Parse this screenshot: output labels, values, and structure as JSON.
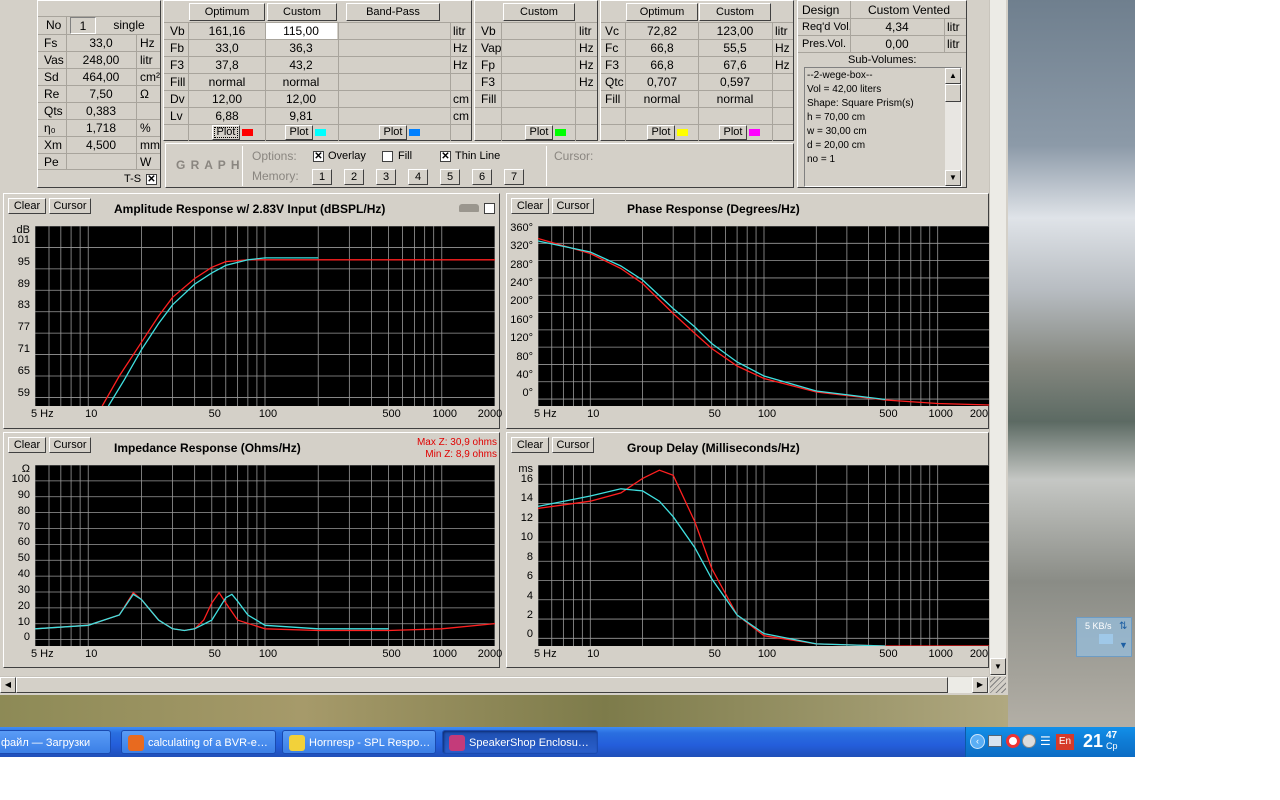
{
  "driver": {
    "no_label": "No",
    "no_value": "1",
    "mode": "single",
    "rows": [
      {
        "label": "Fs",
        "value": "33,0",
        "unit": "Hz"
      },
      {
        "label": "Vas",
        "value": "248,00",
        "unit": "litr"
      },
      {
        "label": "Sd",
        "value": "464,00",
        "unit": "cm²"
      },
      {
        "label": "Re",
        "value": "7,50",
        "unit": "Ω"
      },
      {
        "label": "Qts",
        "value": "0,383",
        "unit": ""
      },
      {
        "label": "η₀",
        "value": "1,718",
        "unit": "%"
      },
      {
        "label": "Xm",
        "value": "4,500",
        "unit": "mm"
      },
      {
        "label": "Pe",
        "value": "",
        "unit": "W"
      }
    ],
    "ts_label": "T-S"
  },
  "vented": {
    "optimum_label": "Optimum",
    "custom_label": "Custom",
    "rows": [
      {
        "label": "Vb",
        "opt": "161,16",
        "cust": "115,00",
        "unit": "litr"
      },
      {
        "label": "Fb",
        "opt": "33,0",
        "cust": "36,3",
        "unit": "Hz"
      },
      {
        "label": "F3",
        "opt": "37,8",
        "cust": "43,2",
        "unit": "Hz"
      },
      {
        "label": "Fill",
        "opt": "normal",
        "cust": "normal",
        "unit": ""
      },
      {
        "label": "Dv",
        "opt": "12,00",
        "cust": "12,00",
        "unit": "cm"
      },
      {
        "label": "Lv",
        "opt": "6,88",
        "cust": "9,81",
        "unit": "cm"
      }
    ]
  },
  "bandpass": {
    "label": "Band-Pass",
    "units": [
      "litr",
      "Hz",
      "Hz",
      "",
      "cm",
      "cm"
    ]
  },
  "passive": {
    "custom_label": "Custom",
    "rows": [
      {
        "label": "Vb",
        "unit": "litr"
      },
      {
        "label": "Vap",
        "unit": "Hz"
      },
      {
        "label": "Fp",
        "unit": "Hz"
      },
      {
        "label": "F3",
        "unit": "Hz"
      },
      {
        "label": "Fill",
        "unit": ""
      }
    ]
  },
  "closed": {
    "optimum_label": "Optimum",
    "custom_label": "Custom",
    "rows": [
      {
        "label": "Vc",
        "opt": "72,82",
        "cust": "123,00",
        "unit": "litr"
      },
      {
        "label": "Fc",
        "opt": "66,8",
        "cust": "55,5",
        "unit": "Hz"
      },
      {
        "label": "F3",
        "opt": "66,8",
        "cust": "67,6",
        "unit": "Hz"
      },
      {
        "label": "Qtc",
        "opt": "0,707",
        "cust": "0,597",
        "unit": ""
      },
      {
        "label": "Fill",
        "opt": "normal",
        "cust": "normal",
        "unit": ""
      }
    ]
  },
  "plot_label": "Plot",
  "plot_colors": {
    "vent_opt": "#ff0000",
    "vent_cust": "#00ffff",
    "bp": "#0080ff",
    "passive": "#00ff00",
    "closed_opt": "#ffff00",
    "closed_cust": "#ff00ff"
  },
  "design": {
    "design_label": "Design",
    "design_value": "Custom Vented",
    "reqd_label": "Req'd Vol.",
    "reqd_value": "4,34",
    "reqd_unit": "litr",
    "pres_label": "Pres.Vol.",
    "pres_value": "0,00",
    "pres_unit": "litr",
    "sub_label": "Sub-Volumes:",
    "sub_lines": [
      "--2-wege-box--",
      "Vol = 42,00 liters",
      "Shape: Square Prism(s)",
      "h = 70,00 cm",
      "w = 30,00 cm",
      "d = 20,00 cm",
      "no = 1"
    ]
  },
  "graph_bar": {
    "graph_label": "G R A P H",
    "options_label": "Options:",
    "overlay": "Overlay",
    "fill": "Fill",
    "thin": "Thin Line",
    "cursor_label": "Cursor:",
    "memory_label": "Memory:",
    "overlay_checked": true,
    "fill_checked": false,
    "thin_checked": true,
    "memory": [
      "1",
      "2",
      "3",
      "4",
      "5",
      "6",
      "7"
    ]
  },
  "clear_label": "Clear",
  "cursor_btn": "Cursor",
  "x_ticks": [
    "5 Hz",
    "10",
    "50",
    "100",
    "500",
    "1000",
    "2000"
  ],
  "amp": {
    "title": "Amplitude Response w/ 2.83V Input (dBSPL/Hz)",
    "unit": "dB",
    "ticks": [
      "101",
      "95",
      "89",
      "83",
      "77",
      "71",
      "65",
      "59"
    ]
  },
  "phase": {
    "title": "Phase Response (Degrees/Hz)",
    "ticks": [
      "360°",
      "320°",
      "280°",
      "240°",
      "200°",
      "160°",
      "120°",
      "80°",
      "40°",
      "0°"
    ],
    "x_last": "200"
  },
  "imp": {
    "title": "Impedance Response (Ohms/Hz)",
    "unit": "Ω",
    "ticks": [
      "100",
      "90",
      "80",
      "70",
      "60",
      "50",
      "40",
      "30",
      "20",
      "10",
      "0"
    ],
    "max": "Max Z: 30,9 ohms",
    "min": "Min Z: 8,9 ohms"
  },
  "gd": {
    "title": "Group Delay (Milliseconds/Hz)",
    "unit": "ms",
    "ticks": [
      "16",
      "14",
      "12",
      "10",
      "8",
      "6",
      "4",
      "2",
      "0"
    ],
    "x_last": "200"
  },
  "chart_data": [
    {
      "type": "line",
      "title": "Amplitude Response w/ 2.83V Input (dBSPL/Hz)",
      "xscale": "log",
      "xlim": [
        5,
        2000
      ],
      "ylim": [
        56,
        104
      ],
      "ylabel": "dB",
      "series": [
        {
          "color": "#ff2020",
          "x": [
            12,
            15,
            20,
            25,
            30,
            40,
            50,
            60,
            80,
            100,
            200,
            500,
            2000
          ],
          "y": [
            56,
            64,
            73,
            80,
            85,
            90,
            93,
            94.5,
            95,
            95,
            95,
            95,
            95
          ]
        },
        {
          "color": "#40e0e0",
          "x": [
            13,
            16,
            20,
            25,
            30,
            40,
            50,
            60,
            80,
            100,
            200
          ],
          "y": [
            56,
            63,
            71,
            78,
            83,
            88.5,
            91.5,
            93.5,
            95,
            95.5,
            95.5
          ]
        }
      ]
    },
    {
      "type": "line",
      "title": "Phase Response (Degrees/Hz)",
      "xscale": "log",
      "xlim": [
        5,
        2000
      ],
      "ylim": [
        0,
        360
      ],
      "series": [
        {
          "color": "#ff2020",
          "x": [
            5,
            10,
            15,
            20,
            30,
            40,
            50,
            70,
            100,
            200,
            500,
            1000,
            2000
          ],
          "y": [
            335,
            305,
            275,
            245,
            185,
            145,
            115,
            80,
            55,
            28,
            12,
            5,
            2
          ]
        },
        {
          "color": "#40e0e0",
          "x": [
            5,
            10,
            15,
            20,
            30,
            40,
            50,
            70,
            100,
            200,
            500
          ],
          "y": [
            330,
            308,
            280,
            252,
            195,
            158,
            125,
            88,
            60,
            30,
            13
          ]
        }
      ]
    },
    {
      "type": "line",
      "title": "Impedance Response (Ohms/Hz)",
      "xscale": "log",
      "xlim": [
        5,
        2000
      ],
      "ylim": [
        0,
        105
      ],
      "ylabel": "Ω",
      "series": [
        {
          "color": "#ff2020",
          "x": [
            5,
            10,
            15,
            18,
            20,
            25,
            30,
            35,
            40,
            45,
            50,
            55,
            60,
            70,
            100,
            200,
            500,
            1000,
            2000
          ],
          "y": [
            10,
            12,
            18,
            30.9,
            27,
            15,
            10,
            9,
            10,
            15,
            25,
            31,
            25,
            15,
            10,
            9,
            9,
            10,
            13
          ]
        },
        {
          "color": "#40e0e0",
          "x": [
            5,
            10,
            15,
            18,
            20,
            25,
            30,
            35,
            40,
            50,
            60,
            65,
            70,
            80,
            100,
            200,
            500
          ],
          "y": [
            10,
            12,
            18,
            30,
            27,
            15,
            10,
            9,
            10,
            15,
            28,
            30,
            26,
            18,
            12,
            10,
            10
          ]
        }
      ]
    },
    {
      "type": "line",
      "title": "Group Delay (Milliseconds/Hz)",
      "xscale": "log",
      "xlim": [
        5,
        2000
      ],
      "ylim": [
        0,
        17.5
      ],
      "ylabel": "ms",
      "series": [
        {
          "color": "#ff2020",
          "x": [
            5,
            10,
            15,
            20,
            25,
            30,
            40,
            50,
            70,
            100,
            200,
            500,
            2000
          ],
          "y": [
            13.3,
            14,
            14.8,
            16.2,
            17,
            16.5,
            12,
            7.5,
            3,
            1,
            0.2,
            0,
            0
          ]
        },
        {
          "color": "#40e0e0",
          "x": [
            5,
            10,
            15,
            20,
            25,
            30,
            40,
            50,
            70,
            100,
            200,
            500
          ],
          "y": [
            13.5,
            14.5,
            15.2,
            15,
            14,
            12.5,
            9.5,
            6.5,
            3,
            1.2,
            0.2,
            0
          ]
        }
      ]
    }
  ],
  "taskbar": {
    "items": [
      {
        "label": "файл — Загрузки",
        "icon": "folder-icon",
        "color": "#e9c46a"
      },
      {
        "label": "calculating of a BVR-e…",
        "icon": "firefox-icon",
        "color": "#e86a1f"
      },
      {
        "label": "Hornresp - SPL Respo…",
        "icon": "hornresp-icon",
        "color": "#f2d13a"
      },
      {
        "label": "SpeakerShop Enclosu…",
        "icon": "speakershop-icon",
        "color": "#c43b7a"
      }
    ],
    "lang": "En",
    "time": "21",
    "minutes": "47",
    "day": "Ср",
    "net": "5 KB/s"
  }
}
